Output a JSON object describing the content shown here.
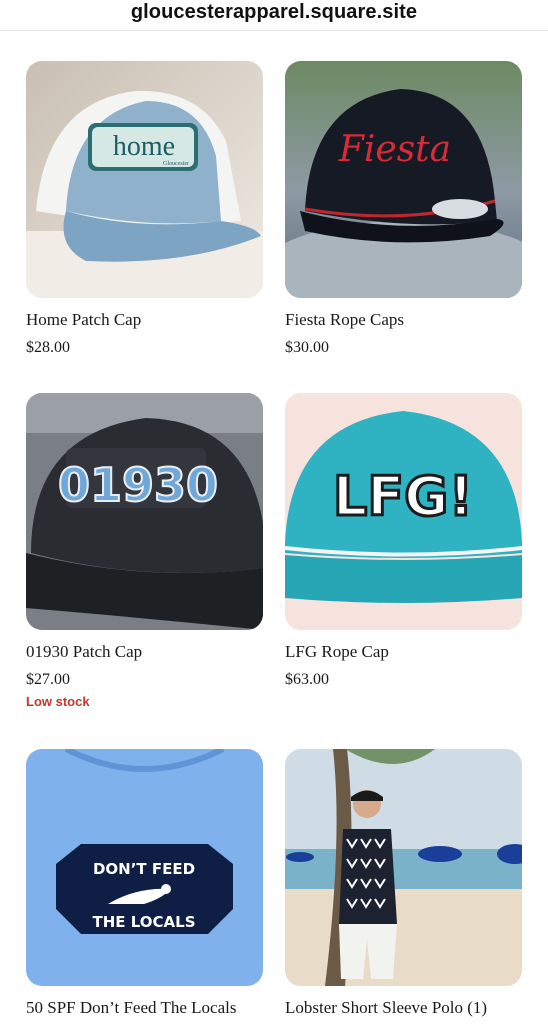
{
  "browser": {
    "url": "gloucesterapparel.square.site"
  },
  "products": [
    {
      "title": "Home Patch Cap",
      "price": "$28.00",
      "patch_text": "home",
      "patch_subtext": "Gloucester"
    },
    {
      "title": "Fiesta Rope Caps",
      "price": "$30.00",
      "patch_text": "Fiesta"
    },
    {
      "title": "01930 Patch Cap",
      "price": "$27.00",
      "badge": "Low stock",
      "patch_text": "01930"
    },
    {
      "title": "LFG Rope Cap",
      "price": "$63.00",
      "patch_text": "LFG!"
    },
    {
      "title": "50 SPF Don’t Feed The Locals",
      "patch_text_top": "DON’T FEED",
      "patch_text_bottom": "THE LOCALS"
    },
    {
      "title": "Lobster Short Sleeve Polo (1)"
    }
  ],
  "colors": {
    "low_stock": "#c0392b"
  }
}
